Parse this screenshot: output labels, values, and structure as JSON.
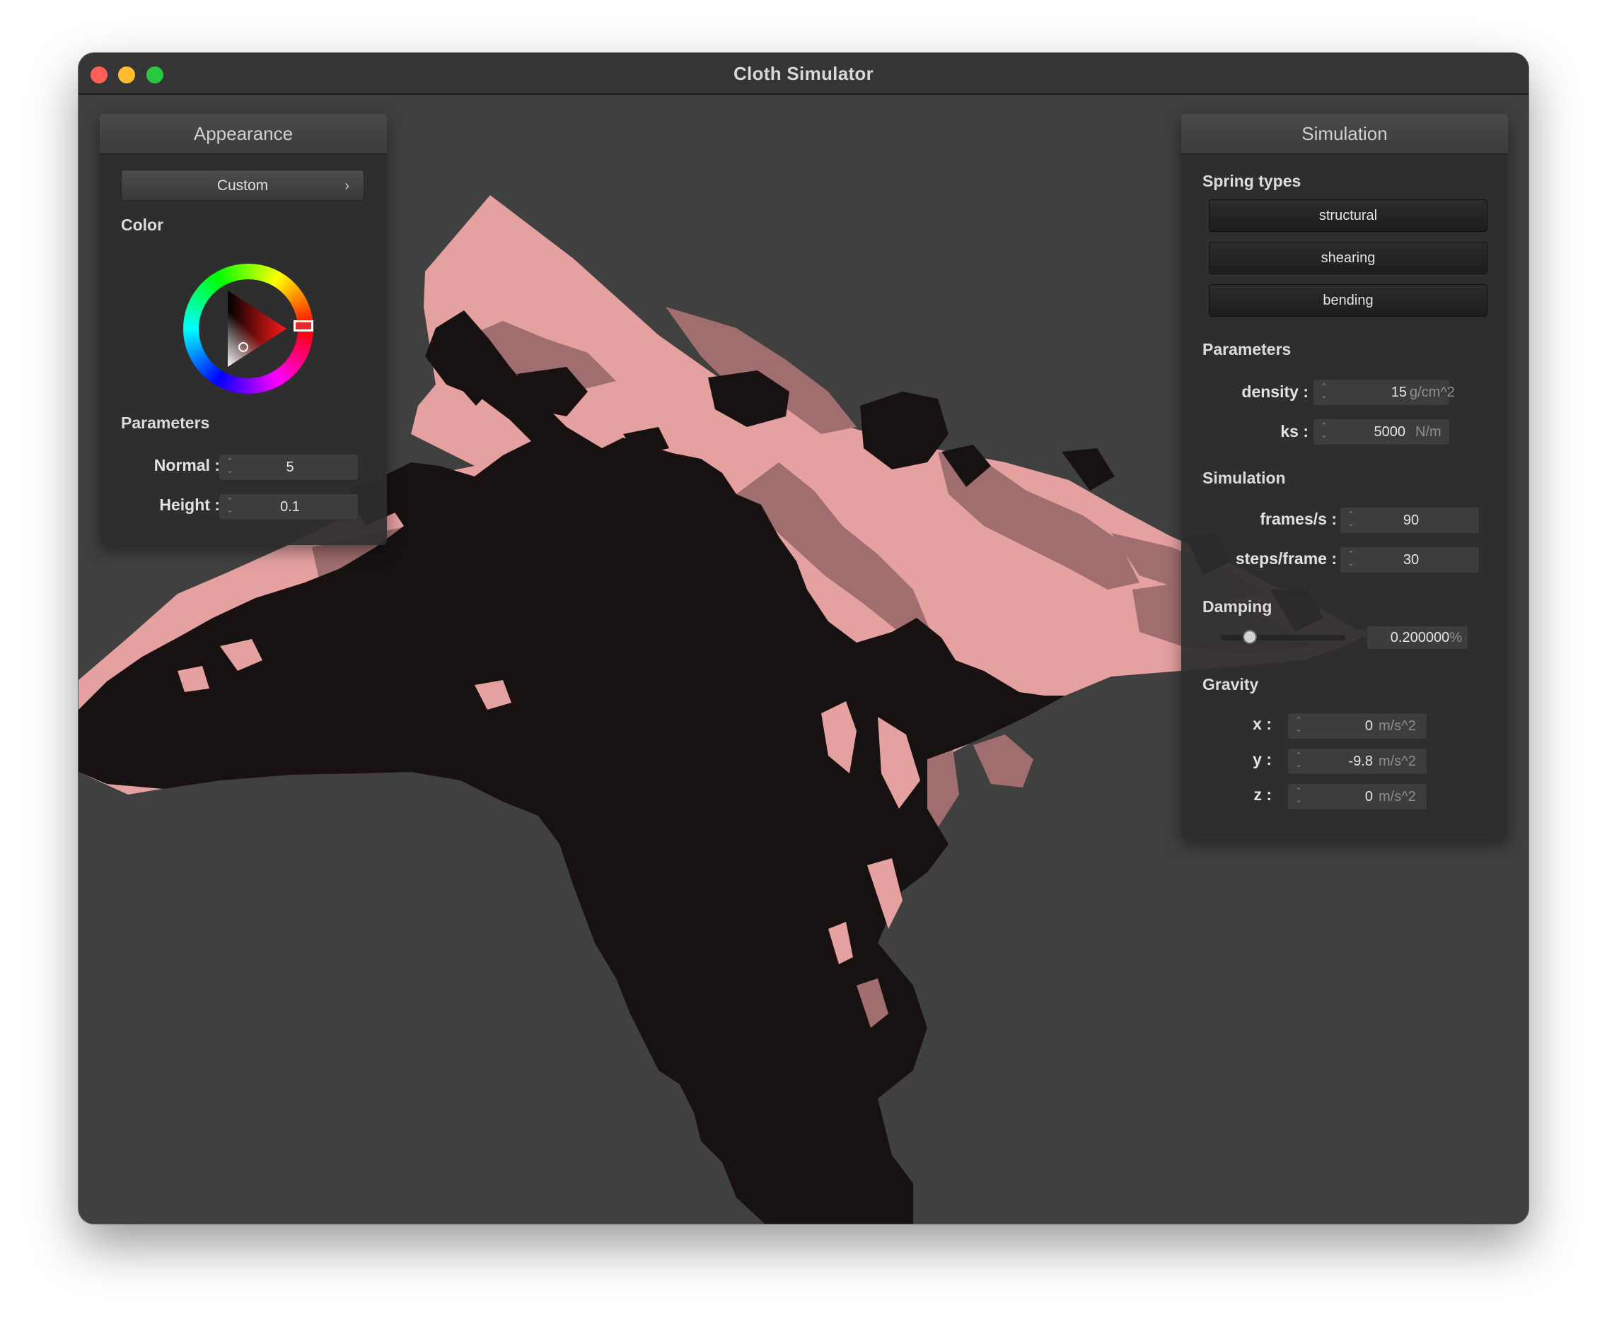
{
  "window": {
    "title": "Cloth Simulator"
  },
  "appearance_panel": {
    "title": "Appearance",
    "preset": "Custom",
    "color_label": "Color",
    "selected_color": "#e5a0a0",
    "parameters_label": "Parameters",
    "normal": {
      "label": "Normal :",
      "value": "5"
    },
    "height": {
      "label": "Height :",
      "value": "0.1"
    }
  },
  "simulation_panel": {
    "title": "Simulation",
    "spring_types_label": "Spring types",
    "spring_types": [
      "structural",
      "shearing",
      "bending"
    ],
    "parameters_label": "Parameters",
    "density": {
      "label": "density :",
      "value": "15",
      "unit": "g/cm^2"
    },
    "ks": {
      "label": "ks :",
      "value": "5000",
      "unit": "N/m"
    },
    "simulation_label": "Simulation",
    "frames_per_s": {
      "label": "frames/s :",
      "value": "90"
    },
    "steps_per_frame": {
      "label": "steps/frame :",
      "value": "30"
    },
    "damping_label": "Damping",
    "damping": {
      "value": "0.200000",
      "unit": "%",
      "slider_fraction": 0.2
    },
    "gravity_label": "Gravity",
    "gravity": [
      {
        "label": "x :",
        "value": "0",
        "unit": "m/s^2"
      },
      {
        "label": "y :",
        "value": "-9.8",
        "unit": "m/s^2"
      },
      {
        "label": "z :",
        "value": "0",
        "unit": "m/s^2"
      }
    ]
  },
  "cloth_colors": {
    "light": "#e5a0a0",
    "mid": "#a06e6e",
    "dark": "#171112",
    "background": "#404040"
  }
}
